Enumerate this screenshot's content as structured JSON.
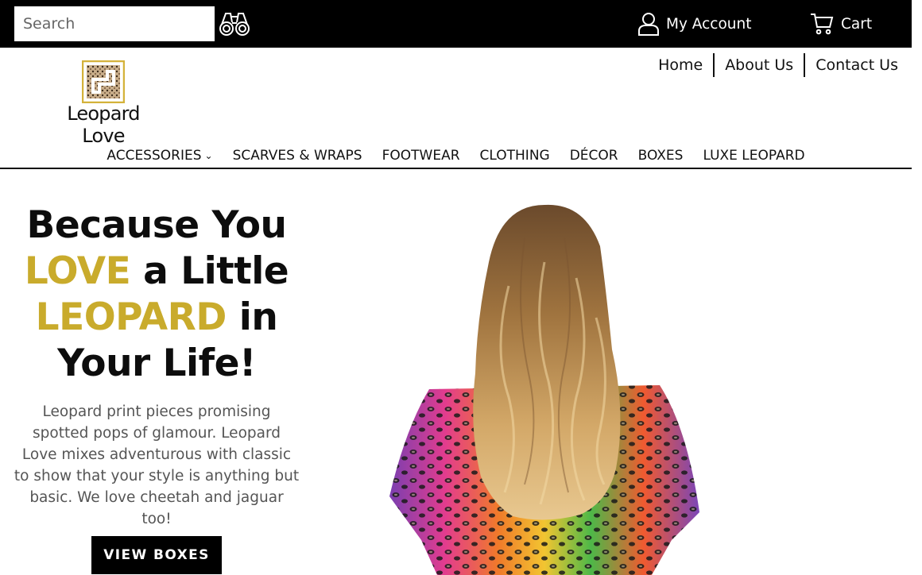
{
  "header": {
    "search_placeholder": "Search",
    "account_label": "My Account",
    "cart_label": "Cart",
    "logo_text": "Leopard Love",
    "utility_nav": [
      "Home",
      "About Us",
      "Contact Us"
    ]
  },
  "main_nav": [
    {
      "label": "ACCESSORIES",
      "has_dropdown": true
    },
    {
      "label": "SCARVES & WRAPS"
    },
    {
      "label": "FOOTWEAR"
    },
    {
      "label": "CLOTHING"
    },
    {
      "label": "DÉCOR"
    },
    {
      "label": "BOXES"
    },
    {
      "label": "LUXE LEOPARD"
    }
  ],
  "hero": {
    "line1": "Because You",
    "love_word": "LOVE",
    "line2_rest": " a Little",
    "leopard_word": "LEOPARD",
    "line3_rest": " in",
    "line4": "Your Life!",
    "body": "Leopard print pieces promising spotted pops of glamour.  Leopard Love mixes adventurous with classic to show that your style is anything but basic. We love cheetah and jaguar too!",
    "cta_label": "VIEW BOXES"
  },
  "colors": {
    "accent_gold": "#c9ab2c",
    "topbar": "#000000",
    "cta": "#000000"
  },
  "icons": [
    "binoculars-icon",
    "user-icon",
    "cart-icon",
    "chevron-down-icon"
  ]
}
